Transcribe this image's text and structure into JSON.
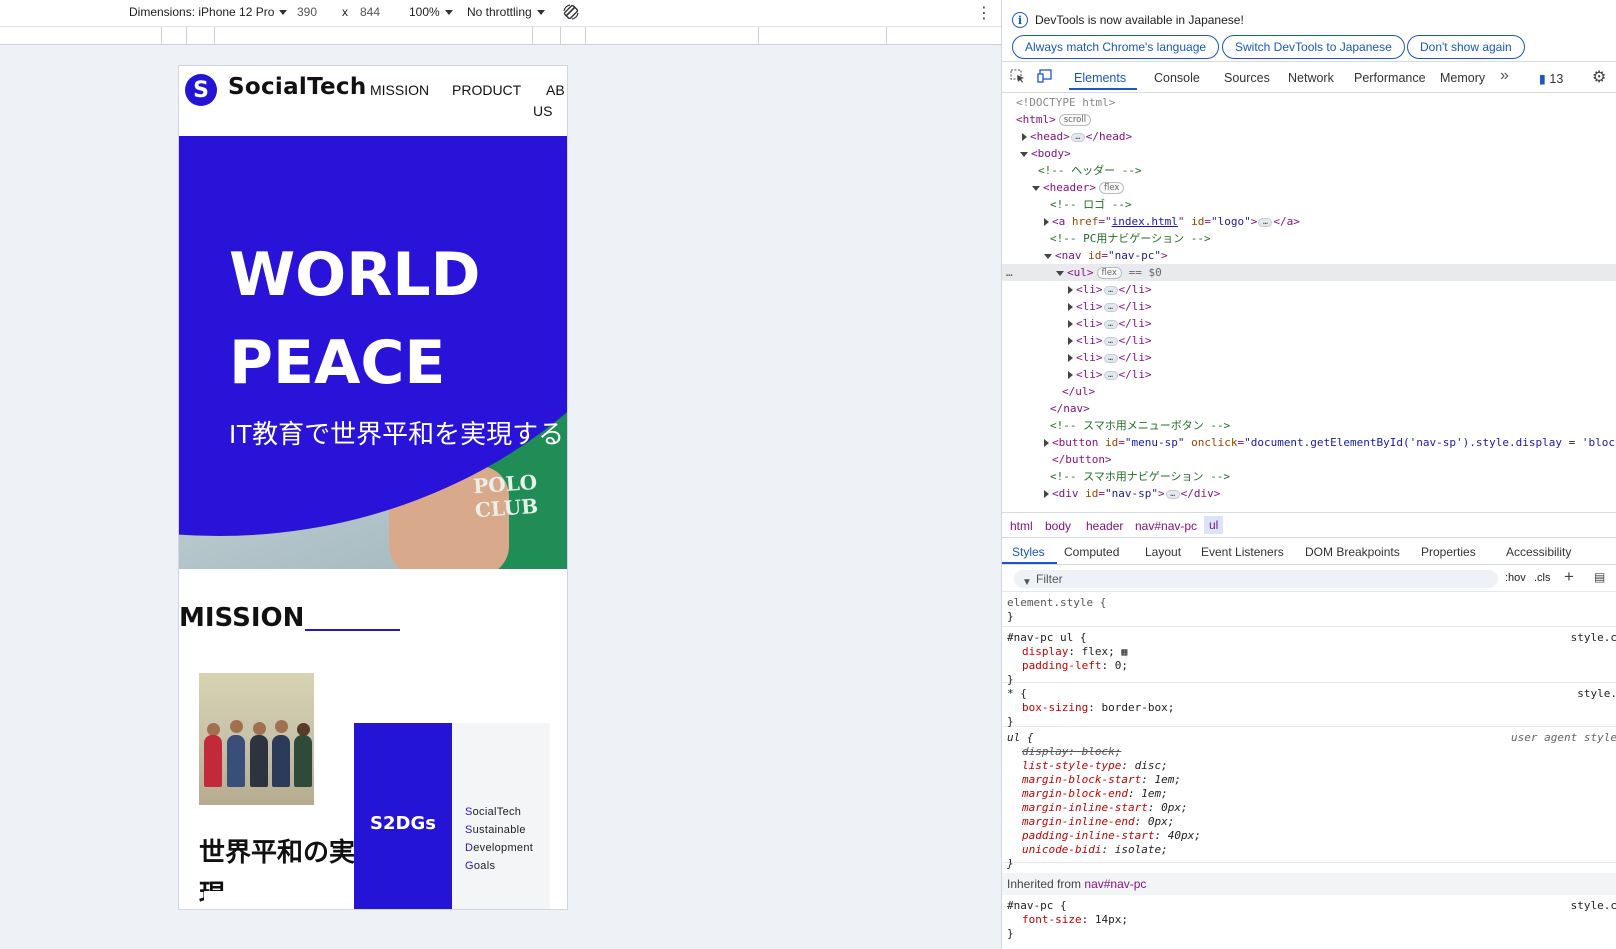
{
  "device_toolbar": {
    "dimensions_label": "Dimensions: iPhone 12 Pro",
    "width": "390",
    "times": "x",
    "height": "844",
    "zoom": "100%",
    "throttling": "No throttling"
  },
  "site": {
    "logo_text": "SocialTech",
    "nav": [
      "MISSION",
      "PRODUCT",
      "AB",
      "US"
    ],
    "hero_title_line1": "WORLD",
    "hero_title_line2": "PEACE",
    "hero_subtitle": "IT教育で世界平和を実現する",
    "hero_photo_text": "POLO CLUB",
    "section_heading": "MISSION",
    "mission_text": "世界平和の実現",
    "s2dgs_label": "S2DGs",
    "s2dgs_lines": [
      {
        "initial": "S",
        "rest": "ocialTech"
      },
      {
        "initial": "S",
        "rest": "ustainable"
      },
      {
        "initial": "D",
        "rest": "evelopment"
      },
      {
        "initial": "G",
        "rest": "oals"
      }
    ]
  },
  "devtools": {
    "info_text": "DevTools is now available in Japanese!",
    "info_buttons": [
      "Always match Chrome's language",
      "Switch DevTools to Japanese",
      "Don't show again"
    ],
    "tabs": [
      "Elements",
      "Console",
      "Sources",
      "Network",
      "Performance",
      "Memory"
    ],
    "issues_count": "13",
    "dom": {
      "doctype": "<!DOCTYPE html>",
      "html_open": "<html>",
      "scroll_badge": "scroll",
      "head": "<head>",
      "head_close": "</head>",
      "body_open": "<body>",
      "comment_header": "<!-- ヘッダー -->",
      "header_open": "<header>",
      "flex_badge": "flex",
      "comment_logo": "<!-- ロゴ -->",
      "a_tag": "<a ",
      "a_href_attr": "href",
      "a_href_val": "index.html",
      "a_id_attr": "id",
      "a_id_val": "\"logo\"",
      "a_close": "</a>",
      "comment_pcnav": "<!-- PC用ナビゲーション -->",
      "nav_open": "<nav ",
      "nav_id_attr": "id",
      "nav_id_val": "\"nav-pc\"",
      "ul_open": "<ul>",
      "selected_marker": "== $0",
      "li_open": "<li>",
      "li_close": "</li>",
      "ul_close": "</ul>",
      "nav_close": "</nav>",
      "comment_menubtn": "<!-- スマホ用メニューボタン -->",
      "button_tag": "<button ",
      "button_id_attr": "id",
      "button_id_val": "\"menu-sp\"",
      "button_onclick_attr": "onclick",
      "button_onclick_val": "\"document.getElementById('nav-sp').style.display = 'block'\"",
      "button_close": "</button>",
      "comment_spnav": "<!-- スマホ用ナビゲーション -->",
      "div_tag": "<div ",
      "div_id_attr": "id",
      "div_id_val": "\"nav-sp\"",
      "div_close": "</div>"
    },
    "breadcrumbs": [
      "html",
      "body",
      "header",
      "nav#nav-pc",
      "ul"
    ],
    "subtabs": [
      "Styles",
      "Computed",
      "Layout",
      "Event Listeners",
      "DOM Breakpoints",
      "Properties",
      "Accessibility"
    ],
    "filter_placeholder": "Filter",
    "hov": ":hov",
    "cls": ".cls",
    "styles": {
      "element_style": "element.style {",
      "close_brace": "}",
      "rule1_selector": "#nav-pc ul {",
      "rule1_source": "style.c",
      "rule1_props": [
        {
          "name": "display",
          "value": "flex;"
        },
        {
          "name": "padding-left",
          "value": "0;"
        }
      ],
      "rule2_selector": "* {",
      "rule2_source": "style.",
      "rule2_props": [
        {
          "name": "box-sizing",
          "value": "border-box;"
        }
      ],
      "rule3_selector": "ul {",
      "rule3_source": "user agent style",
      "rule3_props": [
        {
          "name": "display",
          "value": "block;"
        },
        {
          "name": "list-style-type",
          "value": "disc;"
        },
        {
          "name": "margin-block-start",
          "value": "1em;"
        },
        {
          "name": "margin-block-end",
          "value": "1em;"
        },
        {
          "name": "margin-inline-start",
          "value": "0px;"
        },
        {
          "name": "margin-inline-end",
          "value": "0px;"
        },
        {
          "name": "padding-inline-start",
          "value": "40px;"
        },
        {
          "name": "unicode-bidi",
          "value": "isolate;"
        }
      ],
      "inherited_label": "Inherited from",
      "inherited_from": "nav#nav-pc",
      "rule4_selector": "#nav-pc {",
      "rule4_source": "style.c",
      "rule4_props": [
        {
          "name": "font-size",
          "value": "14px;"
        }
      ]
    }
  }
}
